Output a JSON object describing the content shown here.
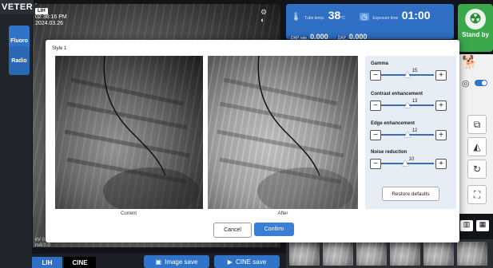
{
  "app": {
    "brand": "VETERA"
  },
  "left_rail": {
    "items": [
      "Fluoro",
      "Radio"
    ]
  },
  "main_view": {
    "tag": "LIH",
    "time": "02:36:16 PM",
    "date": "2024.03.26",
    "bottom_line1": "kV 0",
    "bottom_line2": "mA 0.0"
  },
  "status": {
    "tube_temp_label": "Tube temp.",
    "tube_temp_value": "38",
    "tube_temp_unit": "°C",
    "exposure_label": "Exposure time",
    "exposure_value": "01:00",
    "dap_rate_label": "DAP rate",
    "dap_rate_value": "0.000",
    "dap_label": "DAP",
    "dap_value": "0.000"
  },
  "standby": {
    "label": "Stand by"
  },
  "bottom_bar": {
    "tab_lih": "LIH",
    "tab_cine": "CINE",
    "image_save": "Image save",
    "cine_save": "CINE save"
  },
  "modal": {
    "title": "Style 1",
    "caption_current": "Current",
    "caption_after": "After",
    "sliders": [
      {
        "label": "Gamma",
        "value": "15",
        "fraction": 0.5
      },
      {
        "label": "Contrast enhancement",
        "value": "13",
        "fraction": 0.5
      },
      {
        "label": "Edge enhancement",
        "value": "12",
        "fraction": 0.5
      },
      {
        "label": "Noise reduction",
        "value": "10",
        "fraction": 0.45
      }
    ],
    "minus": "−",
    "plus": "+",
    "restore": "Restore defaults",
    "cancel": "Cancel",
    "confirm": "Confirm"
  },
  "colors": {
    "accent": "#2f74c8",
    "standby": "#3aa84b",
    "panel": "#e6edf5"
  }
}
